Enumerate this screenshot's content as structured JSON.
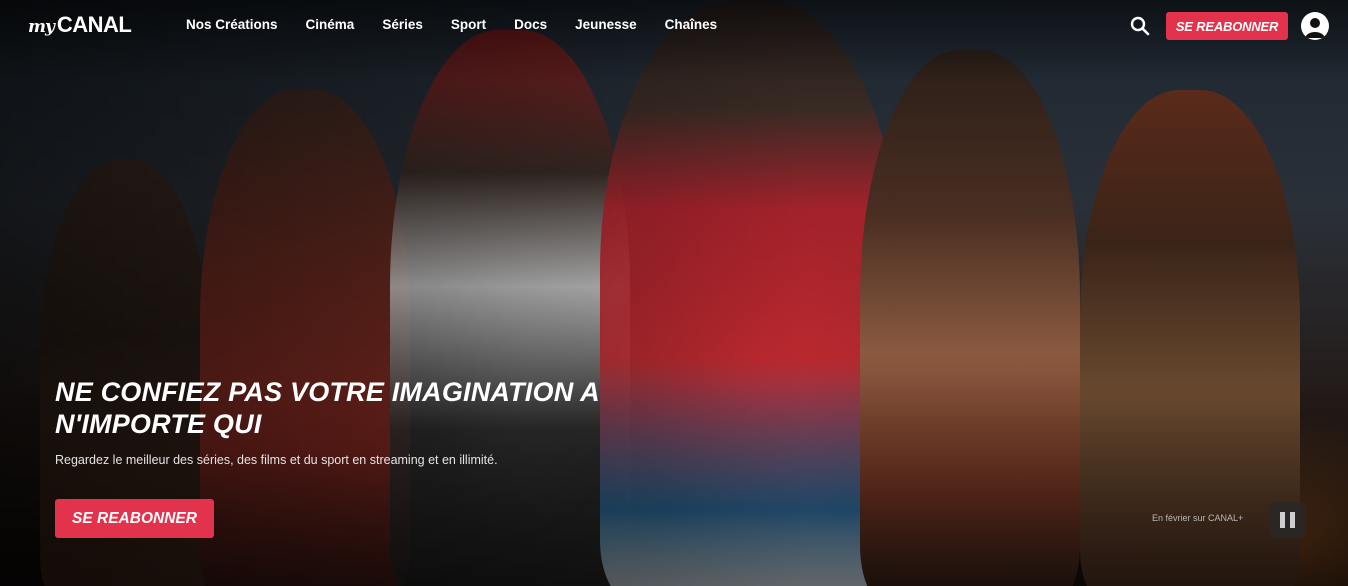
{
  "brand": {
    "logo_my": "my",
    "logo_canal": "CANAL"
  },
  "nav": {
    "items": [
      {
        "label": "Nos Créations"
      },
      {
        "label": "Cinéma"
      },
      {
        "label": "Séries"
      },
      {
        "label": "Sport"
      },
      {
        "label": "Docs"
      },
      {
        "label": "Jeunesse"
      },
      {
        "label": "Chaînes"
      }
    ]
  },
  "header": {
    "subscribe_label": "SE REABONNER",
    "search_icon": "search-icon",
    "account_icon": "user-icon"
  },
  "hero": {
    "title": "NE CONFIEZ PAS VOTRE IMAGINATION A N'IMPORTE QUI",
    "subtitle": "Regardez le meilleur des séries, des films et du sport en streaming et en illimité.",
    "cta_label": "SE REABONNER",
    "caption": "En février sur CANAL+",
    "pause_icon": "pause-icon"
  },
  "colors": {
    "accent": "#e2324c",
    "text": "#ffffff"
  }
}
